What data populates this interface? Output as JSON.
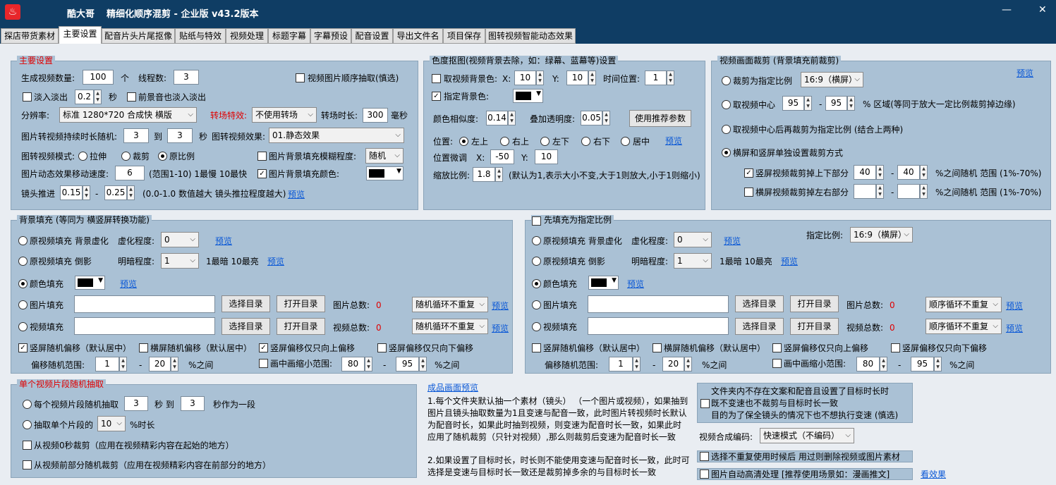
{
  "window": {
    "brand": "酷大哥",
    "title": "精细化顺序混剪 - 企业版 v43.2版本",
    "min": "—",
    "close": "✕",
    "logo": "♨"
  },
  "tabs": [
    "探店带货素材",
    "主要设置",
    "配音片头片尾抠像",
    "贴纸与特效",
    "视频处理",
    "标题字幕",
    "字幕预设",
    "配音设置",
    "导出文件名",
    "项目保存",
    "图转视频智能动态效果"
  ],
  "main": {
    "title": "主要设置",
    "video_count_label": "生成视频数量:",
    "video_count": "100",
    "video_count_unit": "个",
    "threads_label": "线程数:",
    "threads": "3",
    "img_order_label": "视频图片顺序抽取(慎选)",
    "fade_label": "淡入淡出",
    "fade_value": "0.2",
    "fade_unit": "秒",
    "bgm_fade_label": "前景音也淡入淡出",
    "resolution_label": "分辨率:",
    "resolution": "标准 1280*720 合成快 横版",
    "transition_label": "转场特效:",
    "transition": "不使用转场",
    "transition_len_label": "转场时长:",
    "transition_len": "300",
    "transition_len_unit": "毫秒",
    "img_dur_label": "图片转视频持续时长随机:",
    "img_dur_min": "3",
    "img_dur_to": "到",
    "img_dur_max": "3",
    "img_dur_unit": "秒",
    "img_effect_label": "图转视频效果:",
    "img_effect": "01.静态效果",
    "mode_label": "图转视频模式:",
    "mode_stretch": "拉伸",
    "mode_crop": "裁剪",
    "mode_ratio": "原比例",
    "blur_label": "图片背景填充模糊程度:",
    "blur": "随机",
    "speed_label": "图片动态效果移动速度:",
    "speed": "6",
    "speed_hint": "(范围1-10) 1最慢 10最快",
    "bgcolor_label": "图片背景填充颜色:",
    "push_label": "镜头推进",
    "push_min": "0.15",
    "push_max": "0.25",
    "push_hint": "(0.0-1.0 数值越大 镜头推拉程度越大)",
    "preview": "预览"
  },
  "chroma": {
    "title": "色度抠图(视频背景去除，如：绿幕、蓝幕等)设置",
    "take_bg_label": "取视频背景色:",
    "x_label": "X:",
    "x": "10",
    "y_label": "Y:",
    "y": "10",
    "time_pos_label": "时间位置:",
    "time_pos": "1",
    "set_bg_label": "指定背景色:",
    "similarity_label": "颜色相似度:",
    "similarity": "0.14",
    "opacity_label": "叠加透明度:",
    "opacity": "0.05",
    "recommend": "使用推荐参数",
    "pos_label": "位置:",
    "pos_tl": "左上",
    "pos_tr": "右上",
    "pos_bl": "左下",
    "pos_br": "右下",
    "pos_c": "居中",
    "preview": "预览",
    "fine_label": "位置微调",
    "fine_x_label": "X:",
    "fine_x": "-50",
    "fine_y_label": "Y:",
    "fine_y": "10",
    "scale_label": "缩放比例:",
    "scale": "1.8",
    "scale_hint": "(默认为1,表示大小不变,大于1则放大,小于1则缩小)"
  },
  "crop": {
    "title": "视频画面裁剪 (背景填充前裁剪)",
    "preview": "预览",
    "opt1": "裁剪为指定比例",
    "opt1_value": "16:9（横屏）",
    "opt2": "取视频中心",
    "opt2_a": "95",
    "opt2_b": "95",
    "opt2_hint": "% 区域(等同于放大一定比例裁剪掉边缘)",
    "opt3": "取视频中心后再裁剪为指定比例 (结合上两种)",
    "opt4": "横屏和竖屏单独设置裁剪方式",
    "vert_label": "竖屏视频裁剪掉上下部分",
    "vert_a": "40",
    "vert_b": "40",
    "vert_hint": "%之间随机 范围 (1%-70%)",
    "horiz_label": "横屏视频裁剪掉左右部分",
    "horiz_a": "",
    "horiz_b": "",
    "horiz_hint": "%之间随机 范围 (1%-70%)"
  },
  "fill": {
    "title": "背景填充 (等同为 横竖屏转换功能)",
    "orig_blur": "原视频填充 背景虚化",
    "blur_label": "虚化程度:",
    "blur": "0",
    "orig_invert": "原视频填充 倒影",
    "bright_label": "明暗程度:",
    "bright": "1",
    "bright_hint": "1最暗 10最亮",
    "color_fill": "颜色填充",
    "img_fill": "图片填充",
    "vid_fill": "视频填充",
    "select_dir": "选择目录",
    "open_dir": "打开目录",
    "img_total": "图片总数:",
    "img_total_v": "0",
    "vid_total": "视频总数:",
    "vid_total_v": "0",
    "loop": "随机循环不重复",
    "preview": "预览",
    "vert_rand": "竖屏随机偏移（默认居中）",
    "horiz_rand": "横屏随机偏移（默认居中）",
    "up_only": "竖屏偏移仅只向上偏移",
    "down_only": "竖屏偏移仅只向下偏移",
    "offset_label": "偏移随机范围:",
    "offset_a": "1",
    "offset_b": "20",
    "offset_unit": "%之间",
    "pip_label": "画中画缩小范围:",
    "pip_a": "80",
    "pip_b": "95",
    "pip_unit": "%之间"
  },
  "fill2": {
    "title": "先填充为指定比例",
    "ratio_label": "指定比例:",
    "ratio": "16:9（横屏）",
    "loop": "顺序循环不重复"
  },
  "segment": {
    "title": "单个视频片段随机抽取",
    "opt1_a": "每个视频片段随机抽取",
    "opt1_v1": "3",
    "opt1_to": "秒 到",
    "opt1_v2": "3",
    "opt1_b": "秒作为一段",
    "opt2_a": "抽取单个片段的",
    "opt2_v": "10",
    "opt2_b": "%时长",
    "cb1": "从视频0秒裁剪（应用在视频精彩内容在起始的地方）",
    "cb2": "从视频前部分随机裁剪（应用在视频精彩内容在前部分的地方）"
  },
  "notes": {
    "preview": "成品画面预览",
    "p1_l1": "1.每个文件夹默认抽一个素材（镜头） （一个图片或视频），如果抽到",
    "p1_l2": "图片且镜头抽取数量为1且变速与配音一致，此时图片转视频时长默认",
    "p1_l3": "为配音时长，如果此时抽到视频，则变速为配音时长一致，如果此时",
    "p1_l4": "应用了随机裁剪（只针对视频）,那么则裁剪后变速为配音时长一致",
    "p2_l1": "2.如果设置了目标时长，时长则不能使用变速与配音时长一致，此时可",
    "p2_l2": "选择是变速与目标时长一致还是裁剪掉多余的与目标时长一致"
  },
  "extra": {
    "nodub_l1": "文件夹内不存在文案和配音且设置了目标时长时",
    "nodub_l2": "既不变速也不裁剪与目标时长一致",
    "nodub_l3": "目的为了保全镜头的情况下也不想执行变速 (慎选)",
    "codec_label": "视频合成编码:",
    "codec": "快速模式（不编码）",
    "nodup": "选择不重复使用时候后 用过则删除视频或图片素材",
    "hd": "图片自动高清处理 [推荐使用场景如：漫画推文]",
    "hd_link": "看效果"
  }
}
